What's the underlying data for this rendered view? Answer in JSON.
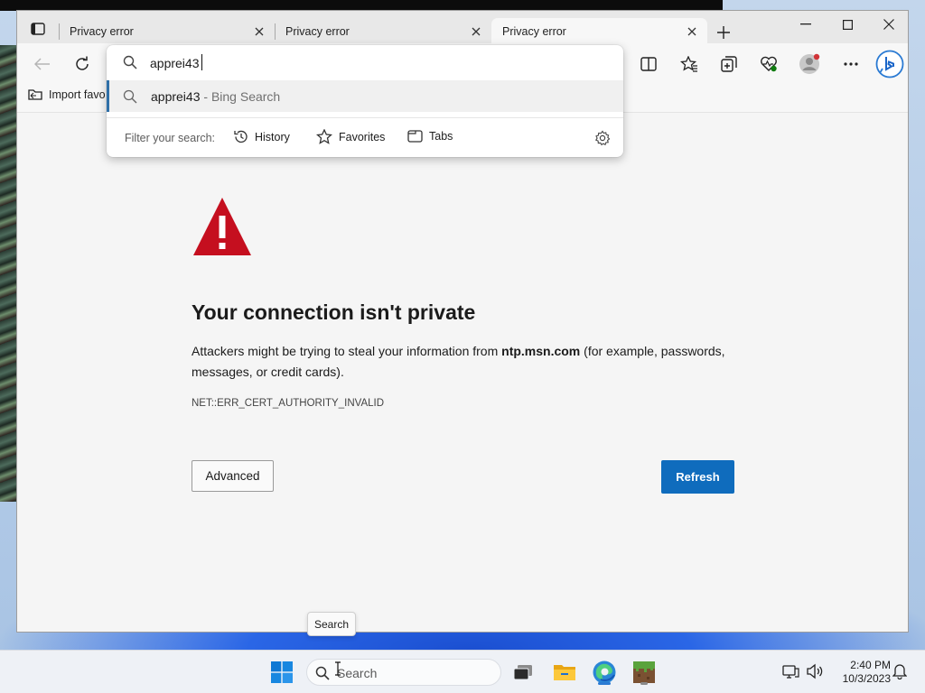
{
  "browser": {
    "tabs": [
      {
        "title": "Privacy error",
        "active": false
      },
      {
        "title": "Privacy error",
        "active": false
      },
      {
        "title": "Privacy error",
        "active": true
      }
    ],
    "favorites_bar": {
      "import_label": "Import favo"
    }
  },
  "omnibox": {
    "query": "apprei43",
    "suggestion": {
      "query": "apprei43",
      "suffix": " - Bing Search"
    },
    "filter": {
      "label": "Filter your search:",
      "chips": [
        "History",
        "Favorites",
        "Tabs"
      ]
    }
  },
  "error_page": {
    "title": "Your connection isn't private",
    "desc_before": "Attackers might be trying to steal your information from ",
    "domain": "ntp.msn.com",
    "desc_after": " (for example, passwords, messages, or credit cards).",
    "code": "NET::ERR_CERT_AUTHORITY_INVALID",
    "advanced_label": "Advanced",
    "refresh_label": "Refresh",
    "warning_color": "#c50f1f",
    "accent_color": "#0f6cbd"
  },
  "taskbar": {
    "tooltip": "Search",
    "search_placeholder": "Search",
    "time": "2:40 PM",
    "date": "10/3/2023",
    "icons": [
      "windows-start-icon",
      "task-view-icon",
      "file-explorer-icon",
      "edge-icon",
      "minecraft-icon"
    ]
  }
}
